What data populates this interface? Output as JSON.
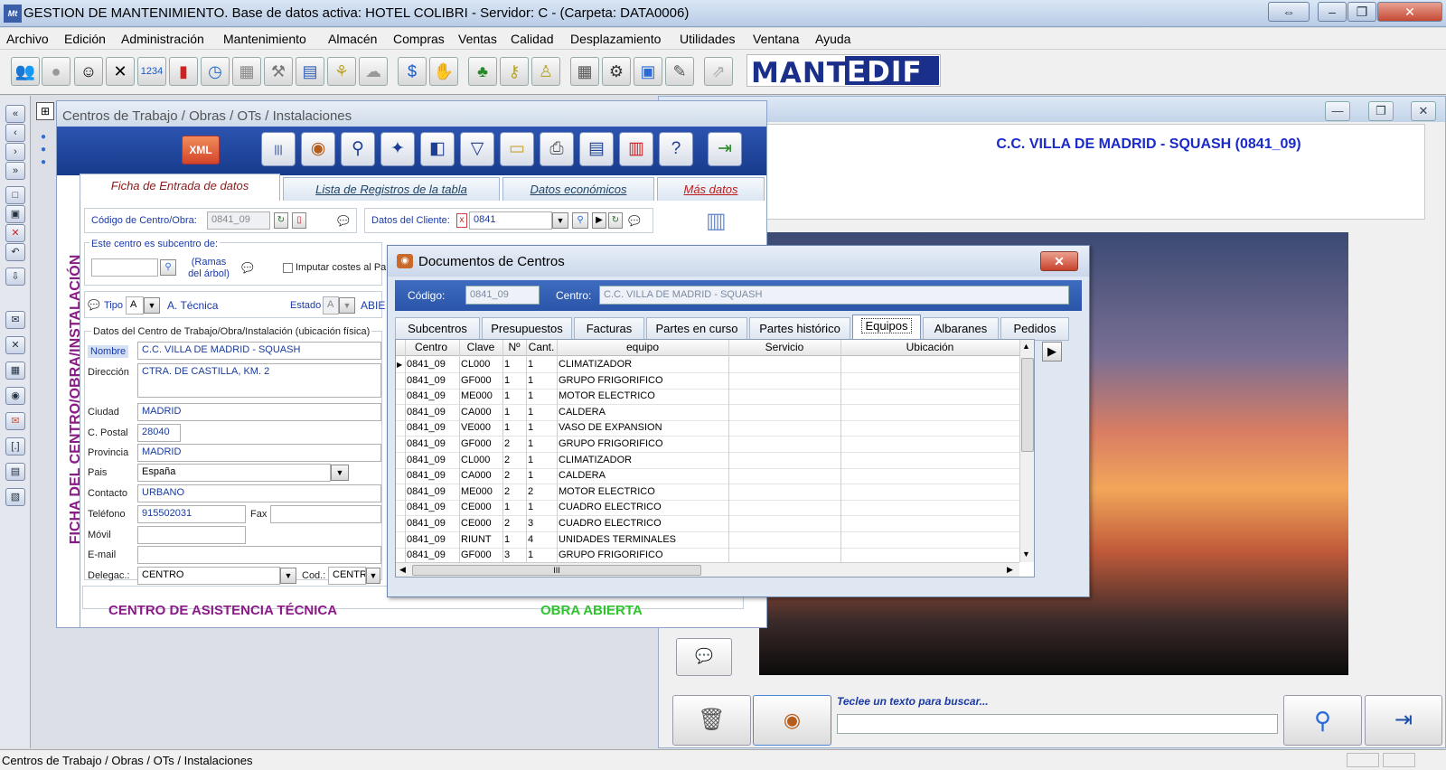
{
  "app": {
    "title": "GESTION DE MANTENIMIENTO. Base de datos activa: HOTEL COLIBRI - Servidor: C - (Carpeta: DATA0006)",
    "icon_text": "Mt"
  },
  "menu": [
    "Archivo",
    "Edición",
    "Administración",
    "Mantenimiento",
    "Almacén",
    "Compras",
    "Ventas",
    "Calidad",
    "Desplazamiento",
    "Utilidades",
    "Ventana",
    "Ayuda"
  ],
  "toolbar": {
    "brand_left": "MANT",
    "brand_right": "EDIF",
    "icons": [
      "users-icon",
      "shadow-user-icon",
      "technician-icon",
      "tools-icon",
      "numbers-icon",
      "fire-extinguisher-icon",
      "clock-icon",
      "grid-icon",
      "hammer-icon",
      "card-icon",
      "organization-icon",
      "cloud-icon",
      "dollar-icon",
      "money-hand-icon",
      "group-icon",
      "users-key-icon",
      "users-money-icon",
      "calendar-icon",
      "forklift-icon",
      "box-icon",
      "clipboard-icon",
      "disabled-icon"
    ]
  },
  "form_window": {
    "title": "Centros de Trabajo / Obras / OTs / Instalaciones",
    "xml_label": "XML",
    "vertical_label": "FICHA DEL CENTRO/OBRA/INSTALACIÓN",
    "tabs": [
      "Ficha de Entrada de datos",
      "Lista de Registros de la tabla",
      "Datos económicos",
      "Más datos"
    ],
    "codigo_label": "Código de Centro/Obra:",
    "codigo_value": "0841_09",
    "cliente_label": "Datos del Cliente:",
    "cliente_value": "0841",
    "subcentro_label": "Este centro es subcentro de:",
    "ramas_label": "(Ramas del árbol)",
    "imputar_label": "Imputar costes al Pa",
    "tipo_label": "Tipo",
    "tipo_value": "A",
    "tipo_desc": "A. Técnica",
    "estado_label": "Estado",
    "estado_value": "A",
    "estado_desc": "ABIE",
    "datos_group": "Datos del Centro de Trabajo/Obra/Instalación (ubicación física)",
    "fields": {
      "nombre_label": "Nombre",
      "nombre": "C.C. VILLA DE MADRID - SQUASH",
      "direccion_label": "Dirección",
      "direccion": "CTRA. DE CASTILLA, KM. 2",
      "ciudad_label": "Ciudad",
      "ciudad": "MADRID",
      "cpostal_label": "C. Postal",
      "cpostal": "28040",
      "provincia_label": "Provincia",
      "provincia": "MADRID",
      "pais_label": "Pais",
      "pais": "España",
      "contacto_label": "Contacto",
      "contacto": "URBANO",
      "telefono_label": "Teléfono",
      "telefono": "915502031",
      "fax_label": "Fax",
      "fax": "",
      "movil_label": "Móvil",
      "movil": "",
      "email_label": "E-mail",
      "email": "",
      "delegac_label": "Delegac.:",
      "delegac": "CENTRO",
      "cod_label": "Cod.:",
      "cod": "CENTR"
    },
    "footer_left": "CENTRO DE ASISTENCIA TÉCNICA",
    "footer_right": "OBRA ABIERTA"
  },
  "right_window": {
    "title": "C.C. VILLA DE MADRID - SQUASH (0841_09)",
    "search_hint": "Teclee un texto para buscar...",
    "search_value": ""
  },
  "doc_dialog": {
    "title": "Documentos de Centros",
    "codigo_label": "Código:",
    "codigo_value": "0841_09",
    "centro_label": "Centro:",
    "centro_value": "C.C. VILLA DE MADRID - SQUASH",
    "tabs": [
      "Subcentros",
      "Presupuestos",
      "Facturas",
      "Partes en curso",
      "Partes histórico",
      "Equipos",
      "Albaranes",
      "Pedidos"
    ],
    "columns": [
      "Centro",
      "Clave",
      "Nº",
      "Cant.",
      "equipo",
      "Servicio",
      "Ubicación"
    ],
    "rows": [
      [
        "0841_09",
        "CL000",
        "1",
        "1",
        "CLIMATIZADOR",
        "",
        ""
      ],
      [
        "0841_09",
        "GF000",
        "1",
        "1",
        "GRUPO FRIGORIFICO",
        "",
        ""
      ],
      [
        "0841_09",
        "ME000",
        "1",
        "1",
        "MOTOR ELECTRICO",
        "",
        ""
      ],
      [
        "0841_09",
        "CA000",
        "1",
        "1",
        "CALDERA",
        "",
        ""
      ],
      [
        "0841_09",
        "VE000",
        "1",
        "1",
        "VASO DE EXPANSION",
        "",
        ""
      ],
      [
        "0841_09",
        "GF000",
        "2",
        "1",
        "GRUPO FRIGORIFICO",
        "",
        ""
      ],
      [
        "0841_09",
        "CL000",
        "2",
        "1",
        "CLIMATIZADOR",
        "",
        ""
      ],
      [
        "0841_09",
        "CA000",
        "2",
        "1",
        "CALDERA",
        "",
        ""
      ],
      [
        "0841_09",
        "ME000",
        "2",
        "2",
        "MOTOR ELECTRICO",
        "",
        ""
      ],
      [
        "0841_09",
        "CE000",
        "1",
        "1",
        "CUADRO ELECTRICO",
        "",
        ""
      ],
      [
        "0841_09",
        "CE000",
        "2",
        "3",
        "CUADRO ELECTRICO",
        "",
        ""
      ],
      [
        "0841_09",
        "RIUNT",
        "1",
        "4",
        "UNIDADES TERMINALES",
        "",
        ""
      ],
      [
        "0841_09",
        "GF000",
        "3",
        "1",
        "GRUPO FRIGORIFICO",
        "",
        ""
      ]
    ],
    "hscroll_thumb": "III"
  },
  "status": {
    "text": "Centros de Trabajo / Obras / OTs / Instalaciones"
  },
  "colors": {
    "accent": "#1a2f8a",
    "vertical_label": "#8a1a86",
    "obra_abierta": "#2ec42e",
    "right_title": "#1a2ac8"
  }
}
